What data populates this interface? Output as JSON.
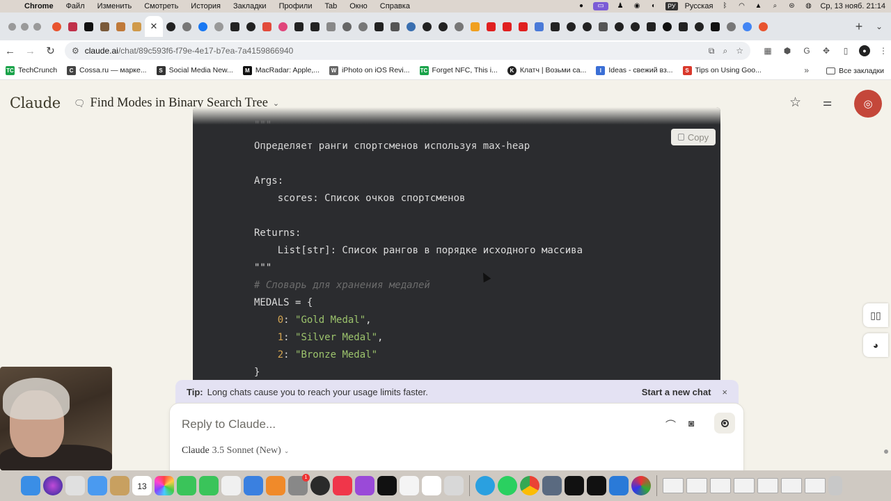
{
  "menubar": {
    "app": "Chrome",
    "items": [
      "Файл",
      "Изменить",
      "Смотреть",
      "История",
      "Закладки",
      "Профили",
      "Tab",
      "Окно",
      "Справка"
    ],
    "lang_badge": "РУ",
    "lang_name": "Русская",
    "datetime": "Ср, 13 нояб.  21:14"
  },
  "toolbar": {
    "url_domain": "claude.ai",
    "url_path": "/chat/89c593f6-f79e-4e17-b7ea-7a4159866940"
  },
  "bookmarks": {
    "items": [
      {
        "label": "TechCrunch",
        "icon": "TC",
        "color": "#1aa34a"
      },
      {
        "label": "Cossa.ru — марке...",
        "icon": "C",
        "color": "#444444"
      },
      {
        "label": "Social Media New...",
        "icon": "S",
        "color": "#333333"
      },
      {
        "label": "MacRadar: Apple,...",
        "icon": "M",
        "color": "#111111"
      },
      {
        "label": "iPhoto on iOS Revi...",
        "icon": "W",
        "color": "#666666"
      },
      {
        "label": "Forget NFC, This i...",
        "icon": "TC",
        "color": "#1aa34a"
      },
      {
        "label": "Клатч | Возьми са...",
        "icon": "K",
        "color": "#222222"
      },
      {
        "label": "Ideas - свежий вз...",
        "icon": "I",
        "color": "#3b6fd6"
      },
      {
        "label": "Tips on Using Goo...",
        "icon": "S",
        "color": "#d9382b"
      }
    ],
    "more": "»",
    "all": "Все закладки"
  },
  "page": {
    "logo": "Claude",
    "chat_title": "Find Modes in Binary Search Tree",
    "avatar_icon": "chat-bubble-icon"
  },
  "code": {
    "copy_label": "Copy",
    "lines": [
      "\"\"\"",
      "Определяет ранги спортсменов используя max-heap",
      "",
      "Args:",
      "    scores: Список очков спортсменов",
      "",
      "Returns:",
      "    List[str]: Список рангов в порядке исходного массива",
      "\"\"\"",
      "# Словарь для хранения медалей",
      "MEDALS = {",
      "    0: \"Gold Medal\",",
      "    1: \"Silver Medal\",",
      "    2: \"Bronze Medal\"",
      "}"
    ]
  },
  "tip": {
    "label": "Tip:",
    "text": "Long chats cause you to reach your usage limits faster.",
    "action": "Start a new chat",
    "close": "×"
  },
  "composer": {
    "placeholder": "Reply to Claude...",
    "model_brand": "Claude",
    "model_name": "3.5 Sonnet (New)"
  },
  "dock": {
    "calendar_day": "13",
    "badge": "1"
  },
  "colors": {
    "accent": "#c4473a",
    "code_bg": "#2b2c2f",
    "tip_bg": "#e4e2f3",
    "page_bg": "#f4f2ea"
  }
}
